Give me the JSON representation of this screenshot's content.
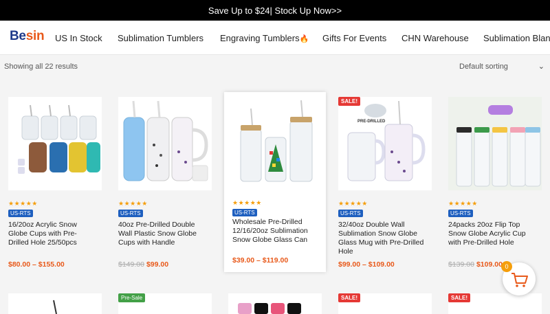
{
  "promo": {
    "text": "Save Up to $24| Stock Up Now>>"
  },
  "header": {
    "logo": {
      "b": "Be",
      "e": "sin"
    },
    "nav": [
      "US In Stock",
      "Sublimation Tumblers",
      "Engraving Tumblers",
      "Gifts For Events",
      "CHN Warehouse",
      "Sublimation Blank"
    ],
    "engraving_icon": "fire-icon"
  },
  "toolbar": {
    "results_text": "Showing all 22 results",
    "sort_value": "Default sorting"
  },
  "products": [
    {
      "title": "16/20oz Acrylic Snow Globe Cups with Pre-Drilled Hole 25/50pcs",
      "badge": "US-RTS",
      "rating_text": "★★★★★",
      "old_price": "",
      "price": "$80.00 – $155.00",
      "label": ""
    },
    {
      "title": "40oz Pre-Drilled Double Wall Plastic Snow Globe Cups with Handle",
      "badge": "US-RTS",
      "rating_text": "★★★★★",
      "old_price": "$149.00",
      "price": "$99.00",
      "label": ""
    },
    {
      "title": "Wholesale Pre-Drilled 12/16/20oz Sublimation Snow Globe Glass Can",
      "badge": "US-RTS",
      "rating_text": "★★★★★",
      "old_price": "",
      "price": "$39.00 – $119.00",
      "label": ""
    },
    {
      "title": "32/40oz Double Wall Sublimation Snow Globe Glass Mug with Pre-Drilled Hole",
      "badge": "US-RTS",
      "rating_text": "★★★★★",
      "old_price": "",
      "price": "$99.00 – $109.00",
      "label": "SALE!",
      "image_text": "PRE-DRILLED"
    },
    {
      "title": "24packs 20oz Flip Top Snow Globe Acrylic Cup with Pre-Drilled Hole",
      "badge": "US-RTS",
      "rating_text": "★★★★★",
      "old_price": "$139.00",
      "price": "$109.00",
      "label": ""
    }
  ],
  "second_row_labels": [
    "",
    "Pre-Sale",
    "",
    "SALE!",
    "SALE!"
  ],
  "cart": {
    "count": "0"
  },
  "colors": {
    "accent": "#e8591a",
    "badge": "#1e5fbf",
    "sale": "#e53935",
    "presale": "#43a047",
    "stars": "#f59e0b"
  }
}
